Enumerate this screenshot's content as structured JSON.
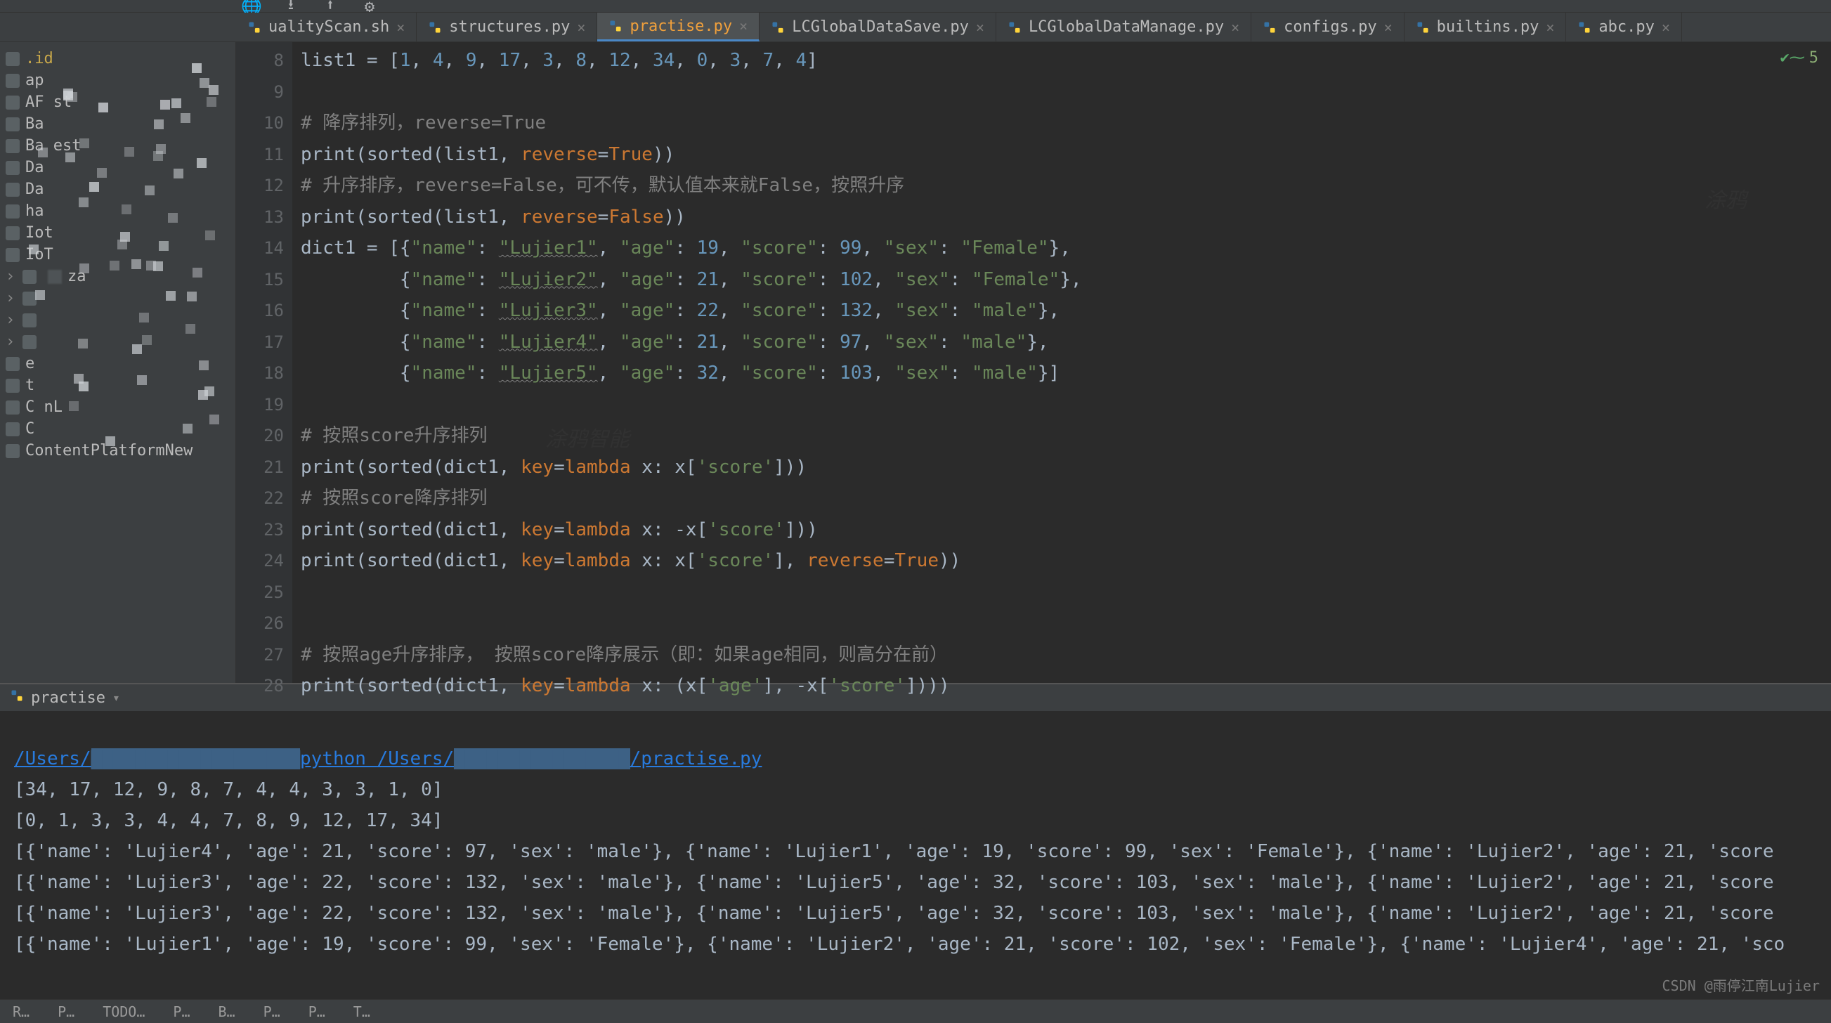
{
  "toolbar_icons": [
    "globe-icon",
    "download-icon",
    "upload-icon",
    "gear-icon",
    "separator"
  ],
  "tabs": [
    {
      "label": "ualityScan.sh",
      "active": false,
      "type": "sh"
    },
    {
      "label": "structures.py",
      "active": false,
      "type": "py"
    },
    {
      "label": "practise.py",
      "active": true,
      "type": "py"
    },
    {
      "label": "LCGlobalDataSave.py",
      "active": false,
      "type": "py"
    },
    {
      "label": "LCGlobalDataManage.py",
      "active": false,
      "type": "py"
    },
    {
      "label": "configs.py",
      "active": false,
      "type": "py"
    },
    {
      "label": "builtins.py",
      "active": false,
      "type": "py"
    },
    {
      "label": "abc.py",
      "active": false,
      "type": "py"
    }
  ],
  "sidebar": {
    "items": [
      {
        "label": ".id",
        "cls": "idea"
      },
      {
        "label": "ap"
      },
      {
        "label": "AF     st"
      },
      {
        "label": "Ba"
      },
      {
        "label": "Ba          est"
      },
      {
        "label": "Da"
      },
      {
        "label": "Da"
      },
      {
        "label": "ha"
      },
      {
        "label": "Iot"
      },
      {
        "label": "IoT"
      },
      {
        "label": "",
        "chev": true,
        "extra": "za"
      },
      {
        "label": "",
        "chev": true
      },
      {
        "label": "",
        "chev": true
      },
      {
        "label": "",
        "chev": true
      },
      {
        "label": "    e"
      },
      {
        "label": "        t"
      },
      {
        "label": "C          nL"
      },
      {
        "label": "C"
      },
      {
        "label": "ContentPlatformNew"
      }
    ]
  },
  "gutter_start": 8,
  "gutter_end": 28,
  "inspection": {
    "count": "5"
  },
  "chart_data": {
    "type": "table",
    "list1": [
      1,
      4,
      9,
      17,
      3,
      8,
      12,
      34,
      0,
      3,
      7,
      4
    ],
    "dict1": [
      {
        "name": "Lujier1",
        "age": 19,
        "score": 99,
        "sex": "Female"
      },
      {
        "name": "Lujier2",
        "age": 21,
        "score": 102,
        "sex": "Female"
      },
      {
        "name": "Lujier3",
        "age": 22,
        "score": 132,
        "sex": "male"
      },
      {
        "name": "Lujier4",
        "age": 21,
        "score": 97,
        "sex": "male"
      },
      {
        "name": "Lujier5",
        "age": 32,
        "score": 103,
        "sex": "male"
      }
    ]
  },
  "code": {
    "l8": {
      "a": "list1 = [",
      "b": "1",
      "c": ", ",
      "d": "4",
      "e": ", ",
      "f": "9",
      "g": ", ",
      "h": "17",
      "i": ", ",
      "j": "3",
      "k": ", ",
      "l": "8",
      "m": ", ",
      "n": "12",
      "o": ", ",
      "p": "34",
      "q": ", ",
      "r": "0",
      "s": ", ",
      "t": "3",
      "u": ", ",
      "v": "7",
      "w": ", ",
      "x": "4",
      "y": "]"
    },
    "l10": "# 降序排列，reverse=True",
    "l11": {
      "a": "print",
      "b": "(",
      "c": "sorted",
      "d": "(list1, ",
      "e": "reverse",
      "f": "=",
      "g": "True",
      "h": "))"
    },
    "l12": "# 升序排序，reverse=False，可不传，默认值本来就False，按照升序",
    "l13": {
      "a": "print",
      "b": "(",
      "c": "sorted",
      "d": "(list1, ",
      "e": "reverse",
      "f": "=",
      "g": "False",
      "h": "))"
    },
    "l14": {
      "a": "dict1 = [{",
      "n": "\"name\"",
      "c1": ": ",
      "v1": "\"Lujier1\"",
      "c2": ", ",
      "ag": "\"age\"",
      "c3": ": ",
      "av": "19",
      "c4": ", ",
      "sc": "\"score\"",
      "c5": ": ",
      "sv": "99",
      "c6": ", ",
      "sx": "\"sex\"",
      "c7": ": ",
      "xv": "\"Female\"",
      "e": "},"
    },
    "l15": {
      "pad": "         {",
      "n": "\"name\"",
      "c1": ": ",
      "v1": "\"Lujier2\"",
      "c2": ", ",
      "ag": "\"age\"",
      "c3": ": ",
      "av": "21",
      "c4": ", ",
      "sc": "\"score\"",
      "c5": ": ",
      "sv": "102",
      "c6": ", ",
      "sx": "\"sex\"",
      "c7": ": ",
      "xv": "\"Female\"",
      "e": "},"
    },
    "l16": {
      "pad": "         {",
      "n": "\"name\"",
      "c1": ": ",
      "v1": "\"Lujier3\"",
      "c2": ", ",
      "ag": "\"age\"",
      "c3": ": ",
      "av": "22",
      "c4": ", ",
      "sc": "\"score\"",
      "c5": ": ",
      "sv": "132",
      "c6": ", ",
      "sx": "\"sex\"",
      "c7": ": ",
      "xv": "\"male\"",
      "e": "},"
    },
    "l17": {
      "pad": "         {",
      "n": "\"name\"",
      "c1": ": ",
      "v1": "\"Lujier4\"",
      "c2": ", ",
      "ag": "\"age\"",
      "c3": ": ",
      "av": "21",
      "c4": ", ",
      "sc": "\"score\"",
      "c5": ": ",
      "sv": "97",
      "c6": ", ",
      "sx": "\"sex\"",
      "c7": ": ",
      "xv": "\"male\"",
      "e": "},"
    },
    "l18": {
      "pad": "         {",
      "n": "\"name\"",
      "c1": ": ",
      "v1": "\"Lujier5\"",
      "c2": ", ",
      "ag": "\"age\"",
      "c3": ": ",
      "av": "32",
      "c4": ", ",
      "sc": "\"score\"",
      "c5": ": ",
      "sv": "103",
      "c6": ", ",
      "sx": "\"sex\"",
      "c7": ": ",
      "xv": "\"male\"",
      "e": "}]"
    },
    "l20": "# 按照score升序排列",
    "l21": {
      "a": "print",
      "b": "(",
      "c": "sorted",
      "d": "(dict1, ",
      "e": "key",
      "f": "=",
      "g": "lambda ",
      "h": "x: x[",
      "i": "'score'",
      "j": "]))"
    },
    "l22": "# 按照score降序排列",
    "l23": {
      "a": "print",
      "b": "(",
      "c": "sorted",
      "d": "(dict1, ",
      "e": "key",
      "f": "=",
      "g": "lambda ",
      "h": "x: -x[",
      "i": "'score'",
      "j": "]))"
    },
    "l24": {
      "a": "print",
      "b": "(",
      "c": "sorted",
      "d": "(dict1, ",
      "e": "key",
      "f": "=",
      "g": "lambda ",
      "h": "x: x[",
      "i": "'score'",
      "j": "], ",
      "k": "reverse",
      "l": "=",
      "m": "True",
      "n": "))"
    },
    "l27": "# 按照age升序排序， 按照score降序展示（即：如果age相同，则高分在前）",
    "l28": {
      "a": "print",
      "b": "(",
      "c": "sorted",
      "d": "(dict1, ",
      "e": "key",
      "f": "=",
      "g": "lambda ",
      "h": "x: (x[",
      "i": "'age'",
      "j": "], -x[",
      "k": "'score'",
      "l": "])))"
    }
  },
  "run": {
    "title": "practise",
    "path1": "/Users/",
    "mid": "python ",
    "path2": "/Users/",
    "path3": "/practise.py",
    "out": [
      "[34, 17, 12, 9, 8, 7, 4, 4, 3, 3, 1, 0]",
      "[0, 1, 3, 3, 4, 4, 7, 8, 9, 12, 17, 34]",
      "[{'name': 'Lujier4', 'age': 21, 'score': 97, 'sex': 'male'}, {'name': 'Lujier1', 'age': 19, 'score': 99, 'sex': 'Female'}, {'name': 'Lujier2', 'age': 21, 'score",
      "[{'name': 'Lujier3', 'age': 22, 'score': 132, 'sex': 'male'}, {'name': 'Lujier5', 'age': 32, 'score': 103, 'sex': 'male'}, {'name': 'Lujier2', 'age': 21, 'score",
      "[{'name': 'Lujier3', 'age': 22, 'score': 132, 'sex': 'male'}, {'name': 'Lujier5', 'age': 32, 'score': 103, 'sex': 'male'}, {'name': 'Lujier2', 'age': 21, 'score",
      "[{'name': 'Lujier1', 'age': 19, 'score': 99, 'sex': 'Female'}, {'name': 'Lujier2', 'age': 21, 'score': 102, 'sex': 'Female'}, {'name': 'Lujier4', 'age': 21, 'sco"
    ]
  },
  "footer": [
    "R",
    "P",
    "TODO",
    "P",
    "B",
    "P",
    "P",
    "T"
  ],
  "credit": "CSDN @雨停江南Lujier"
}
